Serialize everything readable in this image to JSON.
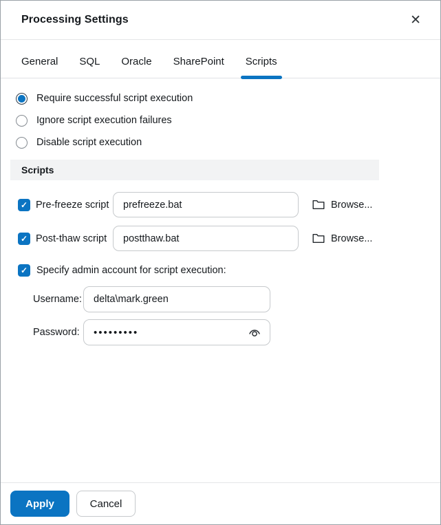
{
  "dialog": {
    "title": "Processing Settings"
  },
  "icons": {
    "close": "✕",
    "checkmark": "✓"
  },
  "tabs": [
    {
      "label": "General",
      "active": false
    },
    {
      "label": "SQL",
      "active": false
    },
    {
      "label": "Oracle",
      "active": false
    },
    {
      "label": "SharePoint",
      "active": false
    },
    {
      "label": "Scripts",
      "active": true
    }
  ],
  "radio_group": {
    "options": [
      {
        "label": "Require successful script execution",
        "selected": true
      },
      {
        "label": "Ignore script execution failures",
        "selected": false
      },
      {
        "label": "Disable script execution",
        "selected": false
      }
    ]
  },
  "section": {
    "header": "Scripts"
  },
  "script_rows": [
    {
      "label": "Pre-freeze script",
      "value": "prefreeze.bat",
      "checked": true,
      "browse_label": "Browse..."
    },
    {
      "label": "Post-thaw script",
      "value": "postthaw.bat",
      "checked": true,
      "browse_label": "Browse..."
    }
  ],
  "admin": {
    "checkbox_label": "Specify admin account for script execution:",
    "checked": true,
    "username_label": "Username:",
    "username_value": "delta\\mark.green",
    "password_label": "Password:",
    "password_value": "•••••••••"
  },
  "footer": {
    "apply_label": "Apply",
    "cancel_label": "Cancel"
  },
  "colors": {
    "accent": "#0b74c2",
    "text": "#15191d",
    "input_border": "#c6c9cc",
    "section_bg": "#f2f3f4",
    "divider": "#e4e6e8"
  }
}
